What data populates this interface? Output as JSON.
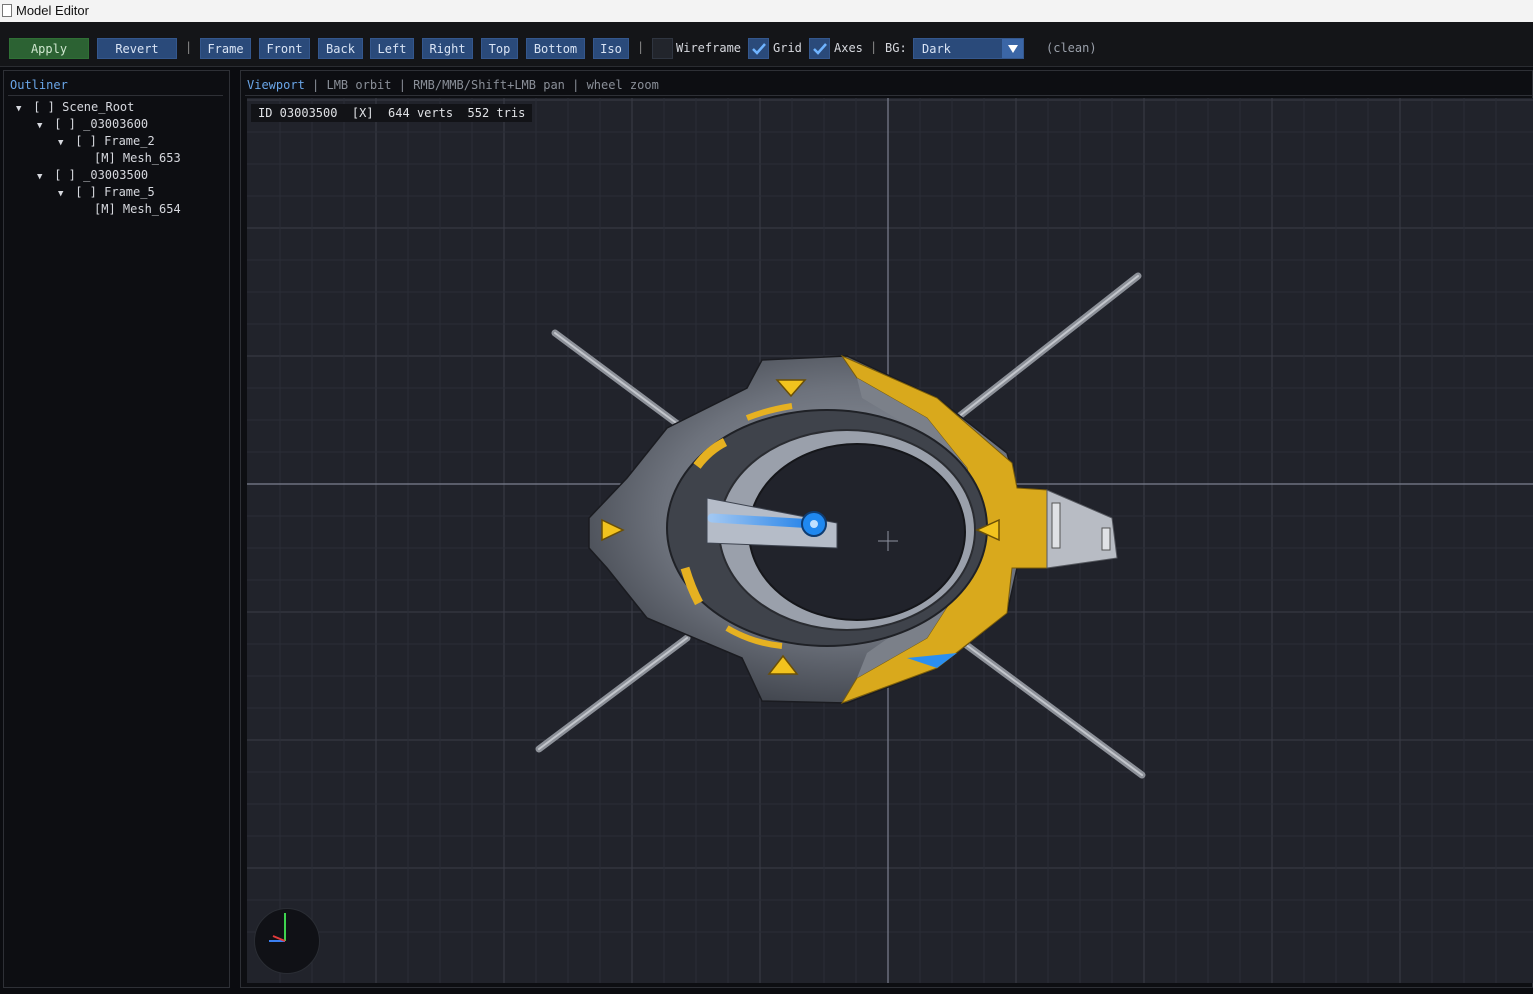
{
  "window": {
    "title": "Model Editor"
  },
  "toolbar": {
    "apply": "Apply",
    "revert": "Revert",
    "sep": "|",
    "views": [
      "Frame",
      "Front",
      "Back",
      "Left",
      "Right",
      "Top",
      "Bottom",
      "Iso"
    ],
    "wireframe": {
      "label": "Wireframe",
      "checked": false
    },
    "grid": {
      "label": "Grid",
      "checked": true
    },
    "axes": {
      "label": "Axes",
      "checked": true
    },
    "bg_label": "BG:",
    "bg_value": "Dark",
    "status": "(clean)"
  },
  "outliner": {
    "title": "Outliner",
    "items": [
      {
        "text": "[ ] Scene_Root",
        "expanded": true
      },
      {
        "text": "[ ] _03003600",
        "expanded": true
      },
      {
        "text": "[ ] Frame_2",
        "expanded": true
      },
      {
        "text": "[M] Mesh_653",
        "expanded": null
      },
      {
        "text": "[ ] _03003500",
        "expanded": true
      },
      {
        "text": "[ ] Frame_5",
        "expanded": true
      },
      {
        "text": "[M] Mesh_654",
        "expanded": null
      }
    ]
  },
  "viewport": {
    "title": "Viewport",
    "hint": "| LMB orbit | RMB/MMB/Shift+LMB pan | wheel zoom",
    "info": "ID 03003500  [X]  644 verts  552 tris",
    "gizmo_axes": [
      "Y",
      "X",
      "Z"
    ]
  },
  "colors": {
    "accent_blue": "#2a4a7a",
    "apply_green": "#2c6233",
    "model_yellow": "#d9a91c",
    "model_blue": "#2b8ff0"
  }
}
